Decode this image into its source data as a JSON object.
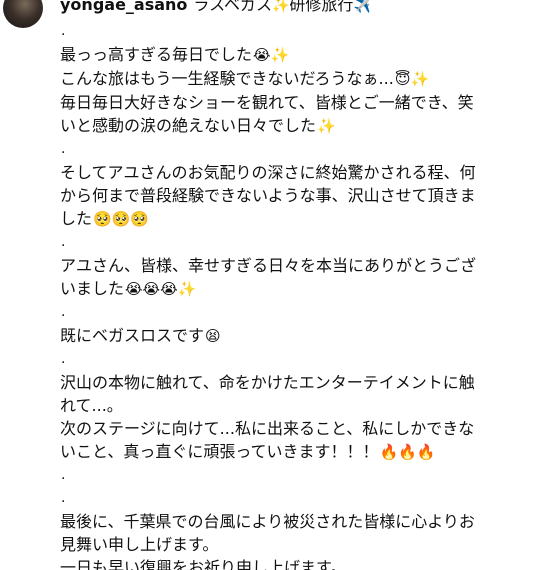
{
  "header": {
    "username": "yongae_asano",
    "caption": "ラスベガス",
    "caption_emoji_1": "✨",
    "caption_suffix": "研修旅行",
    "caption_emoji_2": "✈️"
  },
  "lines": [
    {
      "text": "."
    },
    {
      "text": "最っっ高すぎる毎日でした",
      "emoji": "😭✨"
    },
    {
      "text": "こんな旅はもう一生経験できないだろうなぁ...",
      "emoji": "😇✨"
    },
    {
      "text": "毎日毎日大好きなショーを観れて、皆様とご一緒でき、笑"
    },
    {
      "text": "いと感動の涙の絶えない日々でした",
      "emoji": "✨"
    },
    {
      "text": "."
    },
    {
      "text": "そしてアユさんのお気配りの深さに終始驚かされる程、何"
    },
    {
      "text": "から何まで普段経験できないような事、沢山させて頂きま"
    },
    {
      "text": "した",
      "emoji": "🥺🥺🥺"
    },
    {
      "text": "."
    },
    {
      "text": "アユさん、皆様、幸せすぎる日々を本当にありがとうござ"
    },
    {
      "text": "いました",
      "emoji": "😭😭😭✨"
    },
    {
      "text": "."
    },
    {
      "text": "既にベガスロスです",
      "emoji": "😫"
    },
    {
      "text": "."
    },
    {
      "text": "沢山の本物に触れて、命をかけたエンターテイメントに触"
    },
    {
      "text": "れて...。"
    },
    {
      "text": "次のステージに向けて...私に出来ること、私にしかできな"
    },
    {
      "text": "いこと、真っ直ぐに頑張っていきます！！！",
      "emoji": "🔥🔥🔥"
    },
    {
      "text": "."
    },
    {
      "text": "."
    },
    {
      "text": "最後に、千葉県での台風により被災された皆様に心よりお"
    },
    {
      "text": "見舞い申し上げます。"
    },
    {
      "text": "一日も早い復興をお祈り申し上げます。"
    }
  ]
}
